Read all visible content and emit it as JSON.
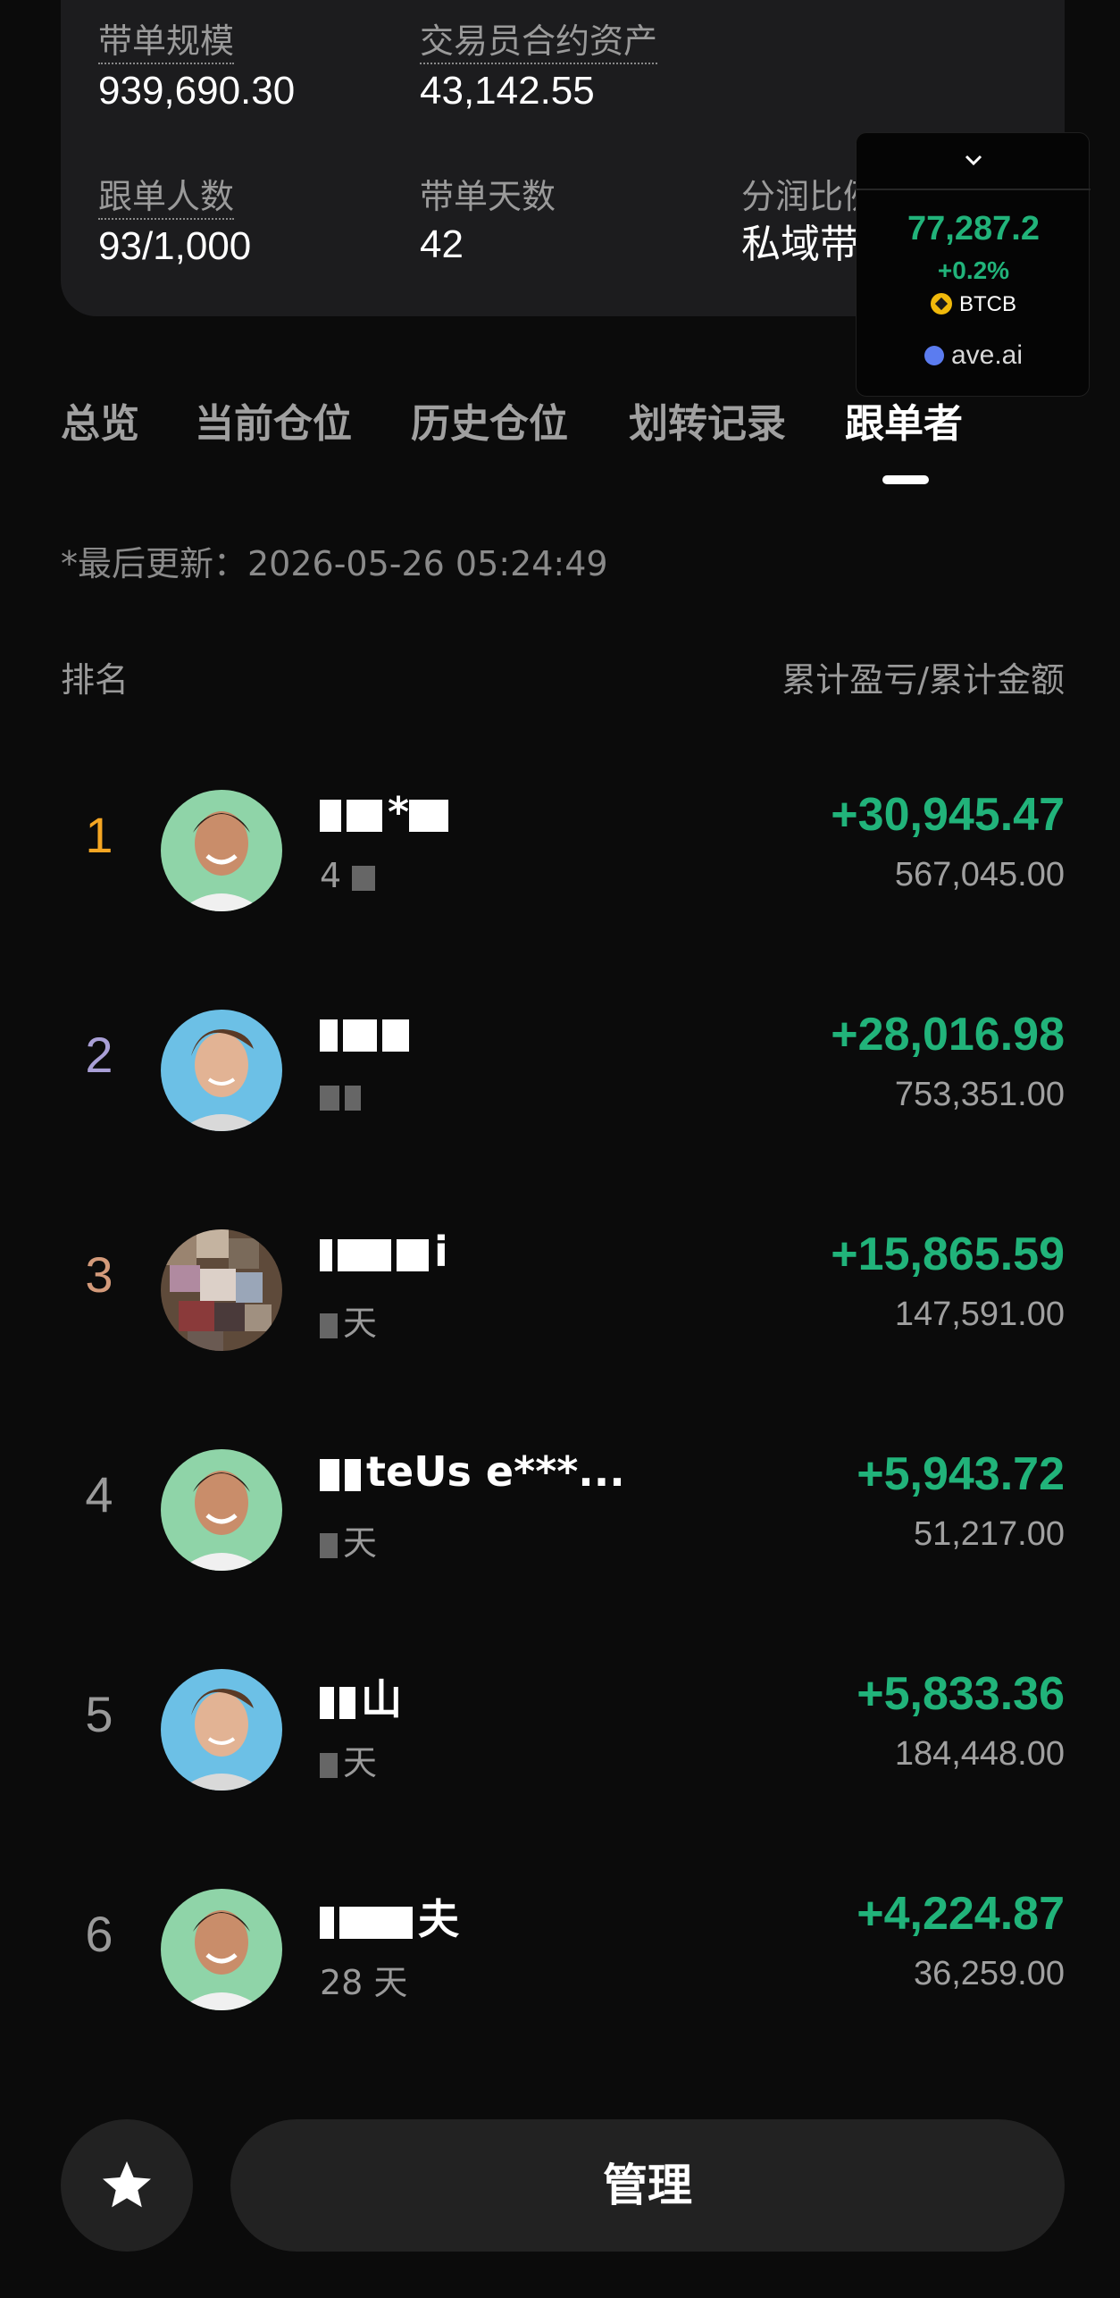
{
  "stats": {
    "copy_scale_label": "带单规模",
    "copy_scale_value": "939,690.30",
    "trader_assets_label": "交易员合约资产",
    "trader_assets_value": "43,142.55",
    "followers_label": "跟单人数",
    "followers_value": "93/1,000",
    "days_label": "带单天数",
    "days_value": "42",
    "profit_share_label": "分润比例",
    "profit_share_value": "私域带单"
  },
  "ticker": {
    "price": "77,287.2",
    "change": "+0.2%",
    "symbol": "BTCB",
    "source": "ave.ai",
    "up_color": "#21b37a"
  },
  "tabs": [
    {
      "label": "总览"
    },
    {
      "label": "当前仓位"
    },
    {
      "label": "历史仓位"
    },
    {
      "label": "划转记录"
    },
    {
      "label": "跟单者"
    }
  ],
  "active_tab": "跟单者",
  "last_updated": "*最后更新：2026-05-26 05:24:49",
  "list_header": {
    "rank_label": "排名",
    "pnl_label": "累计盈亏/累计金额"
  },
  "followers": [
    {
      "rank": "1",
      "name": "*",
      "sub": "4",
      "pnl": "+30,945.47",
      "amount": "567,045.00",
      "rank_color": "#f5a623",
      "avatar": "smiling-man-green"
    },
    {
      "rank": "2",
      "name": "",
      "sub": "",
      "pnl": "+28,016.98",
      "amount": "753,351.00",
      "rank_color": "#a99fd6",
      "avatar": "smiling-man-blue"
    },
    {
      "rank": "3",
      "name": "i",
      "sub": "天",
      "pnl": "+15,865.59",
      "amount": "147,591.00",
      "rank_color": "#d39a7a",
      "avatar": "pixelated-photo"
    },
    {
      "rank": "4",
      "name": "teUs  e***...",
      "sub": "天",
      "pnl": "+5,943.72",
      "amount": "51,217.00",
      "rank_color": "#9a9a9a",
      "avatar": "smiling-man-green"
    },
    {
      "rank": "5",
      "name": "山",
      "sub": "天",
      "pnl": "+5,833.36",
      "amount": "184,448.00",
      "rank_color": "#9a9a9a",
      "avatar": "smiling-man-blue"
    },
    {
      "rank": "6",
      "name": "夫",
      "sub": "28 天",
      "pnl": "+4,224.87",
      "amount": "36,259.00",
      "rank_color": "#9a9a9a",
      "avatar": "smiling-man-green"
    }
  ],
  "bottom": {
    "manage_label": "管理",
    "favorite_icon": "star-icon"
  }
}
